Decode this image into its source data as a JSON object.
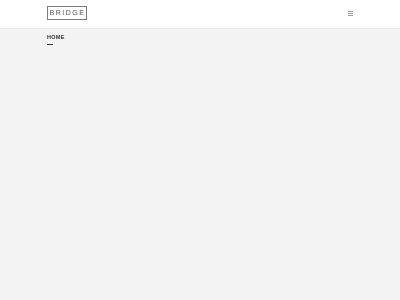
{
  "header": {
    "logo_text": "BRIDGE",
    "menu_icon": "hamburger-menu-icon"
  },
  "page": {
    "title": "HOME"
  },
  "colors": {
    "header_bg": "#ffffff",
    "page_bg": "#f3f3f3",
    "title_text": "#333333"
  }
}
